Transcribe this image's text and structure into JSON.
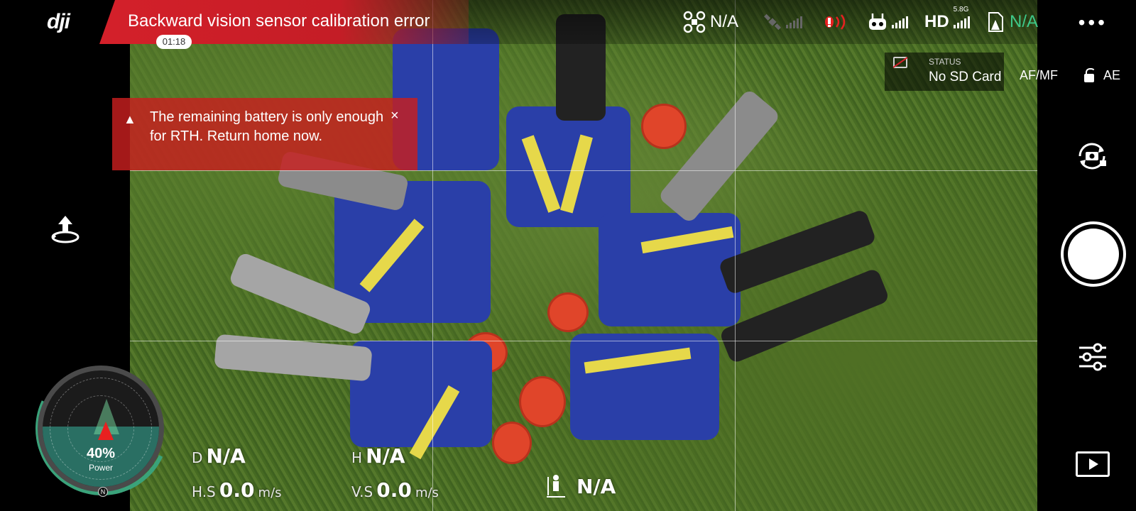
{
  "app": {
    "logo": "dji"
  },
  "alert": {
    "title": "Backward vision sensor calibration error",
    "timer": "01:18"
  },
  "topbar": {
    "aircraft_status": "N/A",
    "hd_band": "5.8G",
    "hd_label": "HD",
    "vision_status": "N/A",
    "more_label": "•••"
  },
  "status": {
    "label": "STATUS",
    "value": "No SD Card"
  },
  "focus": {
    "afmf_label": "AF/MF",
    "ae_label": "AE"
  },
  "battery_warning": {
    "text": "The remaining battery is only enough for RTH. Return home now.",
    "close_label": "×"
  },
  "radar": {
    "percent": "40%",
    "label": "Power",
    "north": "N"
  },
  "telemetry": {
    "distance_label": "D",
    "distance_value": "N/A",
    "height_label": "H",
    "height_value": "N/A",
    "hspeed_label": "H.S",
    "hspeed_value": "0.0",
    "hspeed_unit": "m/s",
    "vspeed_label": "V.S",
    "vspeed_value": "0.0",
    "vspeed_unit": "m/s",
    "vps_value": "N/A"
  },
  "colors": {
    "alert_red": "#d4202a",
    "status_green": "#3ec98a",
    "radar_teal": "#2a6f63"
  }
}
